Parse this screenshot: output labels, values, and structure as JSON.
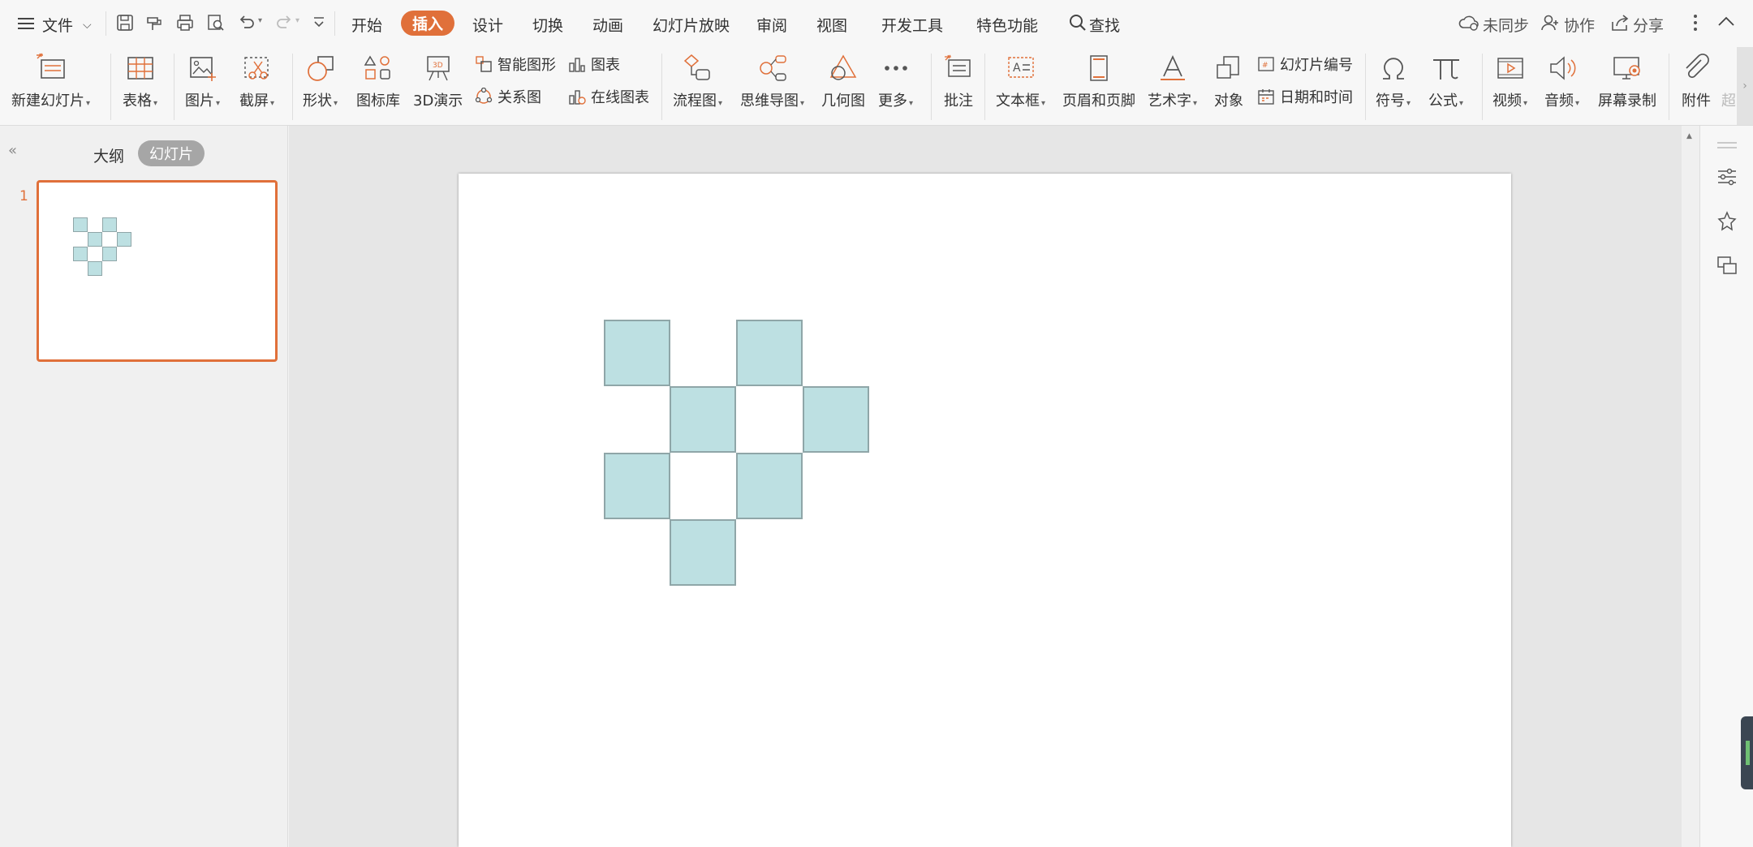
{
  "menubar": {
    "file": "文件",
    "tabs": [
      "开始",
      "插入",
      "设计",
      "切换",
      "动画",
      "幻灯片放映",
      "审阅",
      "视图",
      "开发工具",
      "特色功能"
    ],
    "search": "查找",
    "sync": "未同步",
    "collab": "协作",
    "share": "分享"
  },
  "ribbon": {
    "new_slide": "新建幻灯片",
    "table": "表格",
    "picture": "图片",
    "screenshot": "截屏",
    "shape": "形状",
    "icon_lib": "图标库",
    "demo3d": "3D演示",
    "smart_art": "智能图形",
    "chart": "图表",
    "relation": "关系图",
    "online_chart": "在线图表",
    "flowchart": "流程图",
    "mindmap": "思维导图",
    "geometry": "几何图",
    "more": "更多",
    "comment": "批注",
    "textbox": "文本框",
    "header_footer": "页眉和页脚",
    "wordart": "艺术字",
    "object": "对象",
    "slide_number": "幻灯片编号",
    "datetime": "日期和时间",
    "symbol": "符号",
    "formula": "公式",
    "video": "视频",
    "audio": "音频",
    "screen_record": "屏幕录制",
    "attachment": "附件",
    "overflow": "超"
  },
  "panel": {
    "outline": "大纲",
    "slides": "幻灯片",
    "slide_number": "1"
  },
  "colors": {
    "accent": "#e0703a",
    "shape_fill": "#bde0e2",
    "shape_border": "#8fa6a8"
  }
}
